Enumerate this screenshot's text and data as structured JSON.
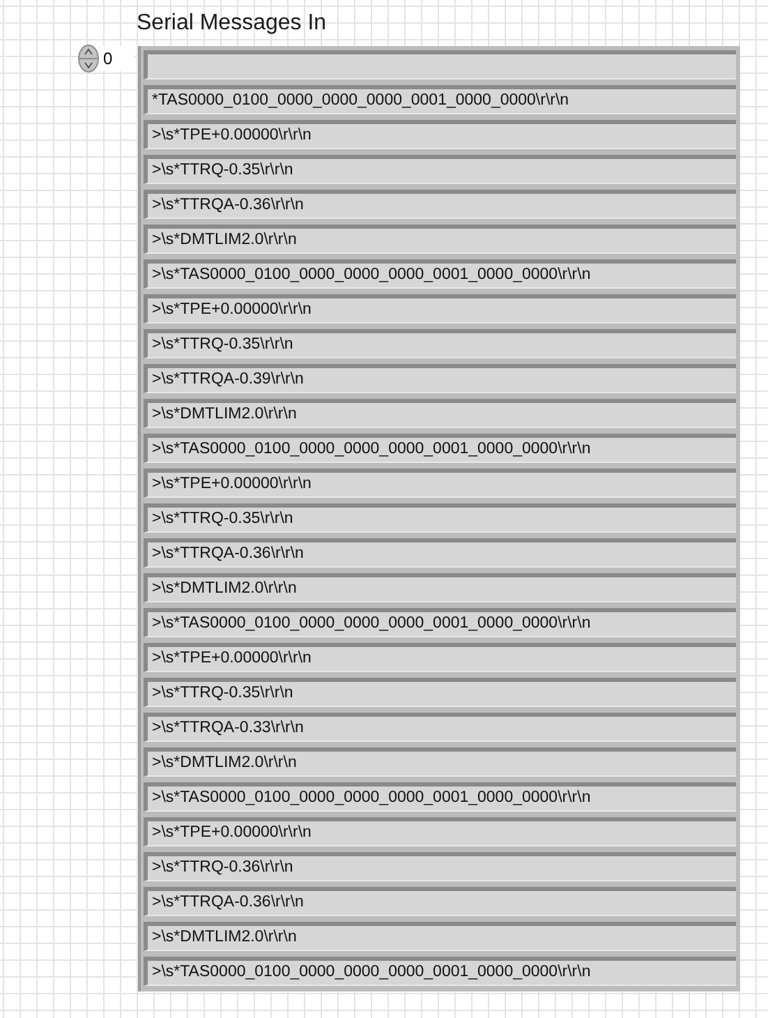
{
  "array": {
    "label": "Serial Messages In",
    "index": "0",
    "elements": [
      "*TAS0000_0100_0000_0000_0000_0001_0000_0000\\r\\r\\n",
      ">\\s*TPE+0.00000\\r\\r\\n",
      ">\\s*TTRQ-0.35\\r\\r\\n",
      ">\\s*TTRQA-0.36\\r\\r\\n",
      ">\\s*DMTLIM2.0\\r\\r\\n",
      ">\\s*TAS0000_0100_0000_0000_0000_0001_0000_0000\\r\\r\\n",
      ">\\s*TPE+0.00000\\r\\r\\n",
      ">\\s*TTRQ-0.35\\r\\r\\n",
      ">\\s*TTRQA-0.39\\r\\r\\n",
      ">\\s*DMTLIM2.0\\r\\r\\n",
      ">\\s*TAS0000_0100_0000_0000_0000_0001_0000_0000\\r\\r\\n",
      ">\\s*TPE+0.00000\\r\\r\\n",
      ">\\s*TTRQ-0.35\\r\\r\\n",
      ">\\s*TTRQA-0.36\\r\\r\\n",
      ">\\s*DMTLIM2.0\\r\\r\\n",
      ">\\s*TAS0000_0100_0000_0000_0000_0001_0000_0000\\r\\r\\n",
      ">\\s*TPE+0.00000\\r\\r\\n",
      ">\\s*TTRQ-0.35\\r\\r\\n",
      ">\\s*TTRQA-0.33\\r\\r\\n",
      ">\\s*DMTLIM2.0\\r\\r\\n",
      ">\\s*TAS0000_0100_0000_0000_0000_0001_0000_0000\\r\\r\\n",
      ">\\s*TPE+0.00000\\r\\r\\n",
      ">\\s*TTRQ-0.36\\r\\r\\n",
      ">\\s*TTRQA-0.36\\r\\r\\n",
      ">\\s*DMTLIM2.0\\r\\r\\n",
      ">\\s*TAS0000_0100_0000_0000_0000_0001_0000_0000\\r\\r\\n"
    ]
  }
}
